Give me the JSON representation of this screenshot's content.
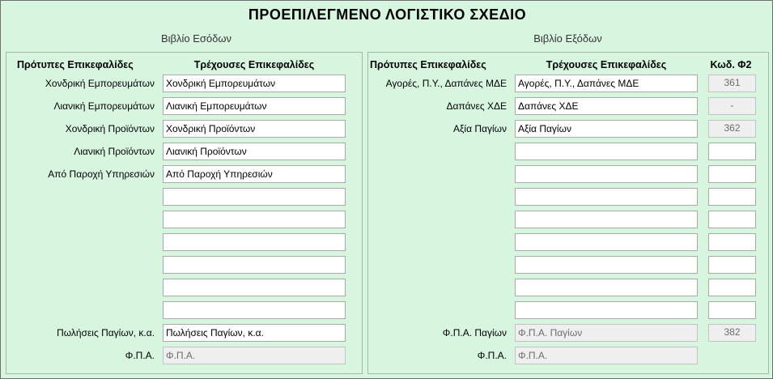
{
  "title": "ΠΡΟΕΠΙΛΕΓΜΕΝΟ ΛΟΓΙΣΤΙΚΟ ΣΧΕΔΙΟ",
  "income": {
    "section_title": "Βιβλίο Εσόδων",
    "col_default": "Πρότυπες Επικεφαλίδες",
    "col_current": "Τρέχουσες Επικεφαλίδες",
    "rows": [
      {
        "label": "Χονδρική Εμπορευμάτων",
        "value": "Χονδρική Εμπορευμάτων"
      },
      {
        "label": "Λιανική Εμπορευμάτων",
        "value": "Λιανική Εμπορευμάτων"
      },
      {
        "label": "Χονδρική Προϊόντων",
        "value": "Χονδρική Προϊόντων"
      },
      {
        "label": "Λιανική Προϊόντων",
        "value": "Λιανική Προϊόντων"
      },
      {
        "label": "Από Παροχή Υπηρεσιών",
        "value": "Από Παροχή Υπηρεσιών"
      },
      {
        "label": "",
        "value": ""
      },
      {
        "label": "",
        "value": ""
      },
      {
        "label": "",
        "value": ""
      },
      {
        "label": "",
        "value": ""
      },
      {
        "label": "",
        "value": ""
      },
      {
        "label": "",
        "value": ""
      },
      {
        "label": "Πωλήσεις Παγίων, κ.α.",
        "value": "Πωλήσεις Παγίων, κ.α."
      },
      {
        "label": "Φ.Π.Α.",
        "value": "Φ.Π.Α.",
        "disabled": true
      }
    ]
  },
  "expenses": {
    "section_title": "Βιβλίο Εξόδων",
    "col_default": "Πρότυπες Επικεφαλίδες",
    "col_current": "Τρέχουσες Επικεφαλίδες",
    "col_code": "Κωδ. Φ2",
    "rows": [
      {
        "label": "Αγορές, Π.Υ., Δαπάνες ΜΔΕ",
        "value": "Αγορές, Π.Υ., Δαπάνες ΜΔΕ",
        "code": "361",
        "code_disabled": true
      },
      {
        "label": "Δαπάνες ΧΔΕ",
        "value": "Δαπάνες ΧΔΕ",
        "code": "-",
        "code_disabled": true
      },
      {
        "label": "Αξία Παγίων",
        "value": "Αξία Παγίων",
        "code": "362",
        "code_disabled": true
      },
      {
        "label": "",
        "value": "",
        "code": ""
      },
      {
        "label": "",
        "value": "",
        "code": ""
      },
      {
        "label": "",
        "value": "",
        "code": ""
      },
      {
        "label": "",
        "value": "",
        "code": ""
      },
      {
        "label": "",
        "value": "",
        "code": ""
      },
      {
        "label": "",
        "value": "",
        "code": ""
      },
      {
        "label": "",
        "value": "",
        "code": ""
      },
      {
        "label": "",
        "value": "",
        "code": ""
      },
      {
        "label": "Φ.Π.Α. Παγίων",
        "value": "Φ.Π.Α. Παγίων",
        "disabled": true,
        "code": "382",
        "code_disabled": true
      },
      {
        "label": "Φ.Π.Α.",
        "value": "Φ.Π.Α.",
        "disabled": true,
        "no_code": true
      }
    ]
  }
}
